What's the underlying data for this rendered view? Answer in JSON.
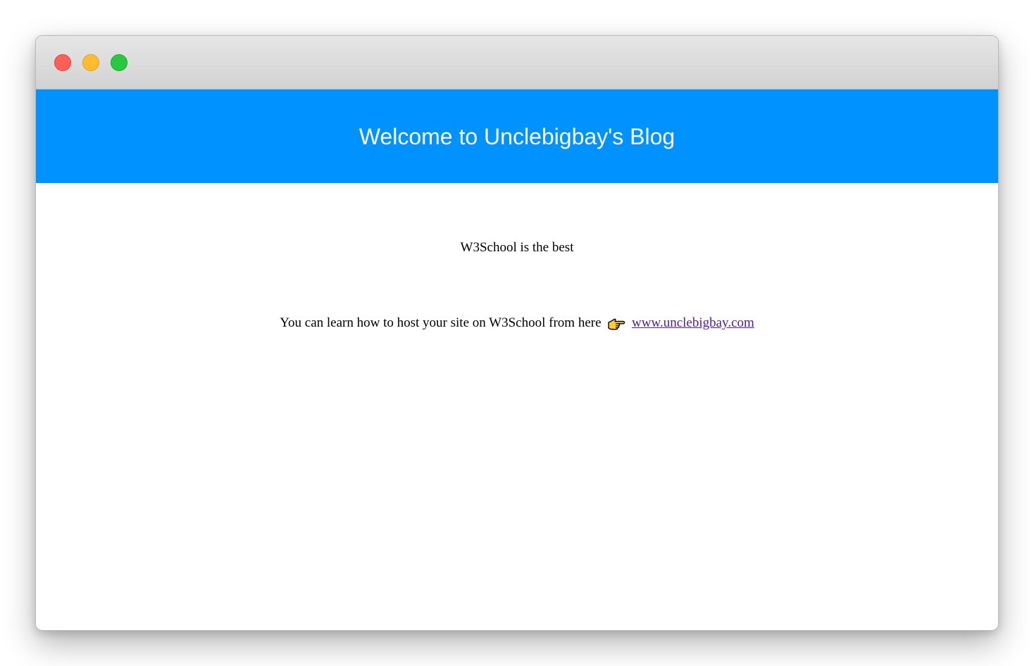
{
  "window": {
    "buttons": {
      "close_color": "#ff5f57",
      "minimize_color": "#febc2e",
      "maximize_color": "#28c840"
    }
  },
  "header": {
    "title": "Welcome to Unclebigbay's Blog",
    "background": "#0092ff"
  },
  "main": {
    "tagline": "W3School is the best",
    "hosting_text": "You can learn how to host your site on W3School from here",
    "pointer_icon": "pointing-right-hand-icon",
    "link_text": "www.unclebigbay.com"
  }
}
